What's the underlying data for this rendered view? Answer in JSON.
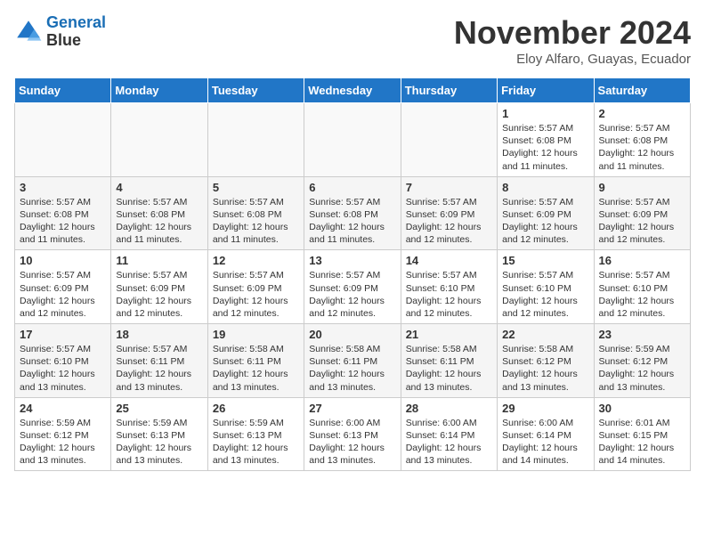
{
  "header": {
    "logo_line1": "General",
    "logo_line2": "Blue",
    "month": "November 2024",
    "location": "Eloy Alfaro, Guayas, Ecuador"
  },
  "weekdays": [
    "Sunday",
    "Monday",
    "Tuesday",
    "Wednesday",
    "Thursday",
    "Friday",
    "Saturday"
  ],
  "weeks": [
    [
      {
        "day": "",
        "info": ""
      },
      {
        "day": "",
        "info": ""
      },
      {
        "day": "",
        "info": ""
      },
      {
        "day": "",
        "info": ""
      },
      {
        "day": "",
        "info": ""
      },
      {
        "day": "1",
        "info": "Sunrise: 5:57 AM\nSunset: 6:08 PM\nDaylight: 12 hours and 11 minutes."
      },
      {
        "day": "2",
        "info": "Sunrise: 5:57 AM\nSunset: 6:08 PM\nDaylight: 12 hours and 11 minutes."
      }
    ],
    [
      {
        "day": "3",
        "info": "Sunrise: 5:57 AM\nSunset: 6:08 PM\nDaylight: 12 hours and 11 minutes."
      },
      {
        "day": "4",
        "info": "Sunrise: 5:57 AM\nSunset: 6:08 PM\nDaylight: 12 hours and 11 minutes."
      },
      {
        "day": "5",
        "info": "Sunrise: 5:57 AM\nSunset: 6:08 PM\nDaylight: 12 hours and 11 minutes."
      },
      {
        "day": "6",
        "info": "Sunrise: 5:57 AM\nSunset: 6:08 PM\nDaylight: 12 hours and 11 minutes."
      },
      {
        "day": "7",
        "info": "Sunrise: 5:57 AM\nSunset: 6:09 PM\nDaylight: 12 hours and 12 minutes."
      },
      {
        "day": "8",
        "info": "Sunrise: 5:57 AM\nSunset: 6:09 PM\nDaylight: 12 hours and 12 minutes."
      },
      {
        "day": "9",
        "info": "Sunrise: 5:57 AM\nSunset: 6:09 PM\nDaylight: 12 hours and 12 minutes."
      }
    ],
    [
      {
        "day": "10",
        "info": "Sunrise: 5:57 AM\nSunset: 6:09 PM\nDaylight: 12 hours and 12 minutes."
      },
      {
        "day": "11",
        "info": "Sunrise: 5:57 AM\nSunset: 6:09 PM\nDaylight: 12 hours and 12 minutes."
      },
      {
        "day": "12",
        "info": "Sunrise: 5:57 AM\nSunset: 6:09 PM\nDaylight: 12 hours and 12 minutes."
      },
      {
        "day": "13",
        "info": "Sunrise: 5:57 AM\nSunset: 6:09 PM\nDaylight: 12 hours and 12 minutes."
      },
      {
        "day": "14",
        "info": "Sunrise: 5:57 AM\nSunset: 6:10 PM\nDaylight: 12 hours and 12 minutes."
      },
      {
        "day": "15",
        "info": "Sunrise: 5:57 AM\nSunset: 6:10 PM\nDaylight: 12 hours and 12 minutes."
      },
      {
        "day": "16",
        "info": "Sunrise: 5:57 AM\nSunset: 6:10 PM\nDaylight: 12 hours and 12 minutes."
      }
    ],
    [
      {
        "day": "17",
        "info": "Sunrise: 5:57 AM\nSunset: 6:10 PM\nDaylight: 12 hours and 13 minutes."
      },
      {
        "day": "18",
        "info": "Sunrise: 5:57 AM\nSunset: 6:11 PM\nDaylight: 12 hours and 13 minutes."
      },
      {
        "day": "19",
        "info": "Sunrise: 5:58 AM\nSunset: 6:11 PM\nDaylight: 12 hours and 13 minutes."
      },
      {
        "day": "20",
        "info": "Sunrise: 5:58 AM\nSunset: 6:11 PM\nDaylight: 12 hours and 13 minutes."
      },
      {
        "day": "21",
        "info": "Sunrise: 5:58 AM\nSunset: 6:11 PM\nDaylight: 12 hours and 13 minutes."
      },
      {
        "day": "22",
        "info": "Sunrise: 5:58 AM\nSunset: 6:12 PM\nDaylight: 12 hours and 13 minutes."
      },
      {
        "day": "23",
        "info": "Sunrise: 5:59 AM\nSunset: 6:12 PM\nDaylight: 12 hours and 13 minutes."
      }
    ],
    [
      {
        "day": "24",
        "info": "Sunrise: 5:59 AM\nSunset: 6:12 PM\nDaylight: 12 hours and 13 minutes."
      },
      {
        "day": "25",
        "info": "Sunrise: 5:59 AM\nSunset: 6:13 PM\nDaylight: 12 hours and 13 minutes."
      },
      {
        "day": "26",
        "info": "Sunrise: 5:59 AM\nSunset: 6:13 PM\nDaylight: 12 hours and 13 minutes."
      },
      {
        "day": "27",
        "info": "Sunrise: 6:00 AM\nSunset: 6:13 PM\nDaylight: 12 hours and 13 minutes."
      },
      {
        "day": "28",
        "info": "Sunrise: 6:00 AM\nSunset: 6:14 PM\nDaylight: 12 hours and 13 minutes."
      },
      {
        "day": "29",
        "info": "Sunrise: 6:00 AM\nSunset: 6:14 PM\nDaylight: 12 hours and 14 minutes."
      },
      {
        "day": "30",
        "info": "Sunrise: 6:01 AM\nSunset: 6:15 PM\nDaylight: 12 hours and 14 minutes."
      }
    ]
  ]
}
